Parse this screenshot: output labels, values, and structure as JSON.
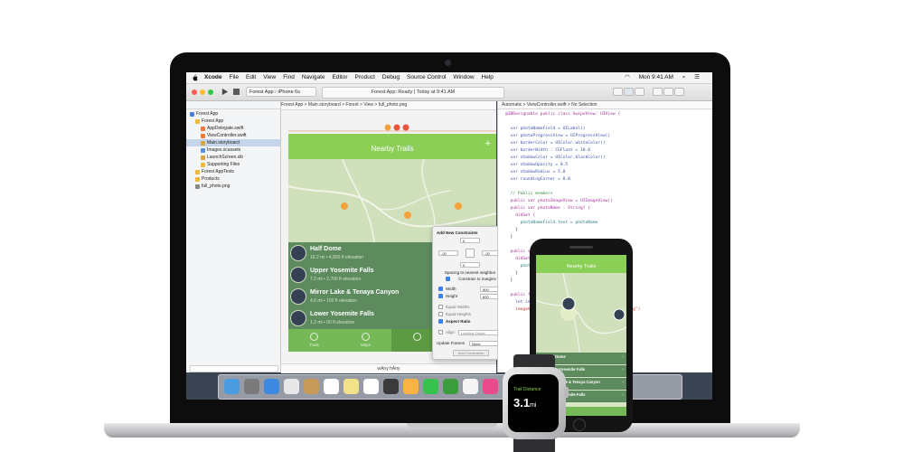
{
  "menubar": {
    "items": [
      "Xcode",
      "File",
      "Edit",
      "View",
      "Find",
      "Navigate",
      "Editor",
      "Product",
      "Debug",
      "Source Control",
      "Window",
      "Help"
    ],
    "clock": "Mon 9:41 AM"
  },
  "toolbar": {
    "scheme": "Forest App",
    "device": "iPhone 6s",
    "status": "Forest App: Ready | Today at 9:41 AM"
  },
  "navigator": {
    "items": [
      {
        "label": "Forest App",
        "level": 0,
        "color": "#4a7fd6"
      },
      {
        "label": "Forest App",
        "level": 1,
        "color": "#f0b93a"
      },
      {
        "label": "AppDelegate.swift",
        "level": 2,
        "color": "#f07a3a"
      },
      {
        "label": "ViewController.swift",
        "level": 2,
        "color": "#f07a3a"
      },
      {
        "label": "Main.storyboard",
        "level": 2,
        "color": "#d9a640",
        "selected": true
      },
      {
        "label": "Images.xcassets",
        "level": 2,
        "color": "#5b8ee0"
      },
      {
        "label": "LaunchScreen.xib",
        "level": 2,
        "color": "#d9a640"
      },
      {
        "label": "Supporting Files",
        "level": 2,
        "color": "#f0b93a"
      },
      {
        "label": "Forest AppTests",
        "level": 1,
        "color": "#f0b93a"
      },
      {
        "label": "Products",
        "level": 1,
        "color": "#f0b93a"
      },
      {
        "label": "full_photo.png",
        "level": 1,
        "color": "#8a8a8a"
      }
    ]
  },
  "storyboard": {
    "jumpbar": "Forest App  >  Main.storyboard  >  Forest  >  View  >  full_photo.png",
    "scene_title": "Nearby Trails",
    "trails": [
      {
        "name": "Half Dome",
        "detail": "16.2 mi • 4,800 ft elevation"
      },
      {
        "name": "Upper Yosemite Falls",
        "detail": "7.2 mi • 2,700 ft elevation"
      },
      {
        "name": "Mirror Lake & Tenaya Canyon",
        "detail": "4.6 mi • 100 ft elevation"
      },
      {
        "name": "Lower Yosemite Falls",
        "detail": "1.2 mi • 50 ft elevation"
      }
    ],
    "tabs": [
      "Trails",
      "Maps",
      "",
      ""
    ],
    "size_class": "wAny  hAny"
  },
  "constraints_popover": {
    "title": "Add New Constraints",
    "top_value": "0",
    "left_value": "-20",
    "right_value": "-20",
    "bottom_value": "0",
    "spacing_label": "Spacing to nearest neighbor",
    "margins_label": "Constrain to margins",
    "width_label": "Width",
    "width_value": "600",
    "height_label": "Height",
    "height_value": "600",
    "equal_widths": "Equal Widths",
    "equal_heights": "Equal Heights",
    "aspect_ratio": "Aspect Ratio",
    "align_label": "Align",
    "align_value": "Leading Edges",
    "update_frames_label": "Update Frames",
    "update_frames_value": "None",
    "add_button": "Add Constraints"
  },
  "editor": {
    "jumpbar": "Automatic  >  ViewController.swift  >  No Selection",
    "lines": [
      {
        "text": "@IBDesignable public class SwipeView: UIView {",
        "color": "#a3329a"
      },
      {
        "text": "",
        "color": "#222222"
      },
      {
        "text": "  var photoNameField = UILabel()",
        "color": "#3a57a8"
      },
      {
        "text": "  var photoProgressView = UIProgressView()",
        "color": "#3a57a8"
      },
      {
        "text": "  var borderColor = UIColor.whiteColor()",
        "color": "#3a57a8"
      },
      {
        "text": "  var borderWidth : CGFloat = 10.0",
        "color": "#3a57a8"
      },
      {
        "text": "  var shadowColor = UIColor.blackColor()",
        "color": "#3a57a8"
      },
      {
        "text": "  var shadowOpacity = 0.5",
        "color": "#3a57a8"
      },
      {
        "text": "  var shadowRadius = 5.0",
        "color": "#3a57a8"
      },
      {
        "text": "  var roundingCorner = 8.0",
        "color": "#3a57a8"
      },
      {
        "text": "",
        "color": "#222222"
      },
      {
        "text": "  // Public members",
        "color": "#3f8a3f"
      },
      {
        "text": "  public var photoImageView = UIImageView()",
        "color": "#a3329a"
      },
      {
        "text": "  public var photoName : String? {",
        "color": "#a3329a"
      },
      {
        "text": "    didSet {",
        "color": "#a3329a"
      },
      {
        "text": "      photoNameField.text = photoName",
        "color": "#2c7a8a"
      },
      {
        "text": "    }",
        "color": "#222222"
      },
      {
        "text": "  }",
        "color": "#222222"
      },
      {
        "text": "",
        "color": "#222222"
      },
      {
        "text": "  public var photoProgress : Int? {",
        "color": "#a3329a"
      },
      {
        "text": "    didSet {",
        "color": "#a3329a"
      },
      {
        "text": "      photoProgressView.progress = photoProgress",
        "color": "#2c7a8a"
      },
      {
        "text": "    }",
        "color": "#222222"
      },
      {
        "text": "  }",
        "color": "#222222"
      },
      {
        "text": "",
        "color": "#222222"
      },
      {
        "text": "  public func commonInit(frame: CGRect) {",
        "color": "#a3329a"
      },
      {
        "text": "    let imageView = UIImageView()",
        "color": "#3a57a8"
      },
      {
        "text": "    imageView.image = UIImage(named: \"full_photo.png\")",
        "color": "#c0392b"
      }
    ]
  },
  "dock": {
    "apps": [
      "#4b9be0",
      "#7a7a7a",
      "#3d8be0",
      "#e8e8e8",
      "#c79a5a",
      "#ffffff",
      "#f2e38a",
      "#ffffff",
      "#3a3a3a",
      "#ffb347",
      "#37c14f",
      "#3b9d3b",
      "#f5f5f5",
      "#e84b8a",
      "#4a90e2",
      "#2ea84a",
      "#8ab4d8",
      "#b0b0b0"
    ]
  },
  "iphone": {
    "title": "Nearby Trails",
    "trails": [
      "Half Dome",
      "Upper Yosemite Falls",
      "Mirror Lake & Tenaya Canyon",
      "Lower Yosemite Falls"
    ]
  },
  "watch": {
    "label": "Trail Distance",
    "value": "3.1",
    "unit": "mi"
  },
  "colors": {
    "accent_green": "#8ccf57",
    "trail_row": "#5d8b5e",
    "xcode_selection": "#c5d6ec"
  }
}
